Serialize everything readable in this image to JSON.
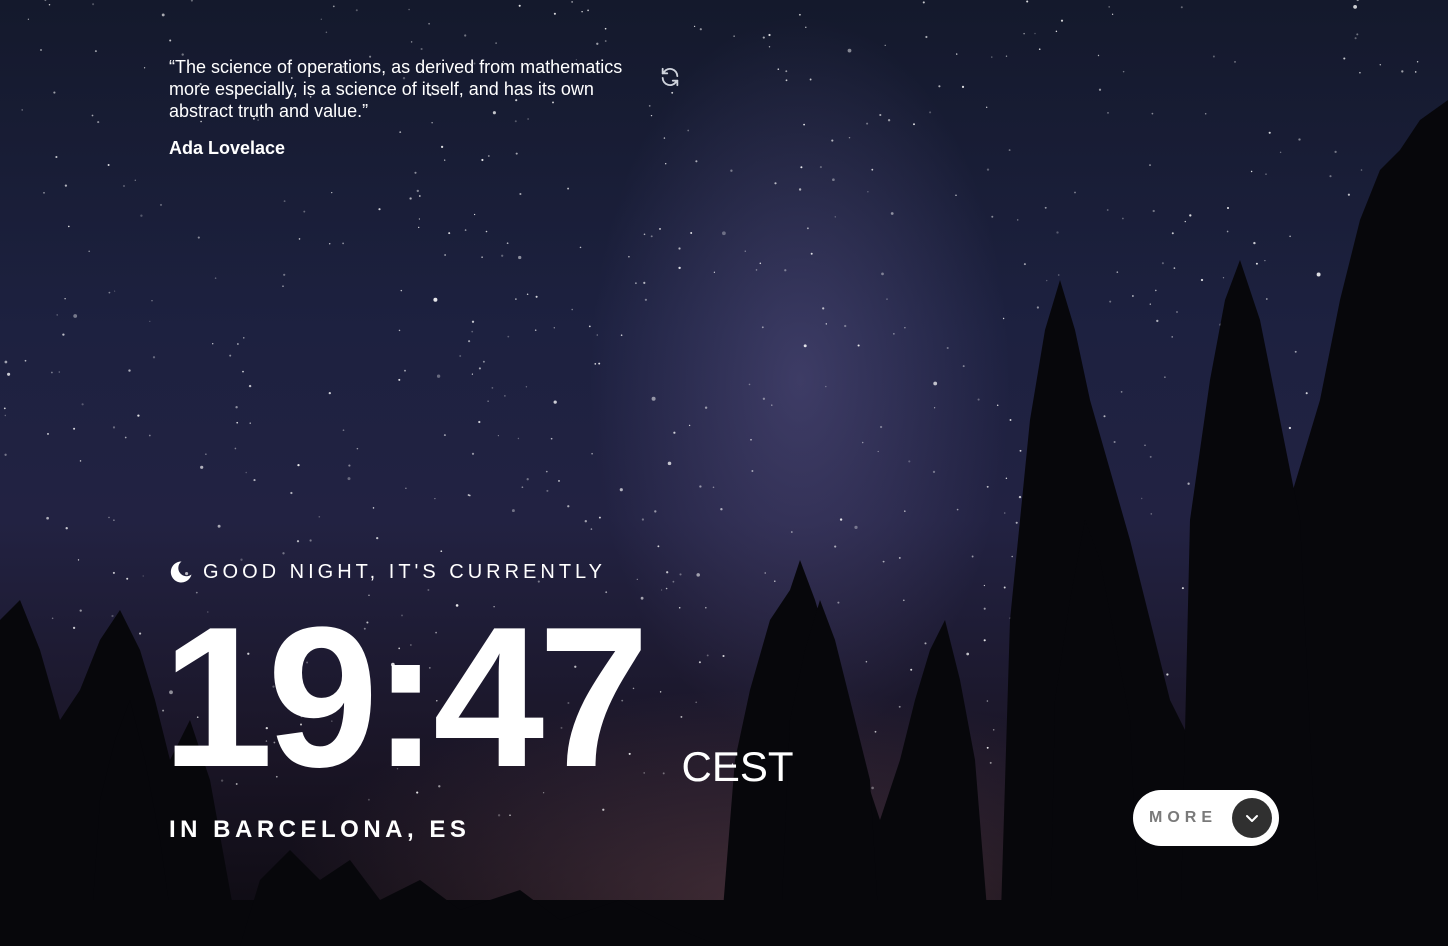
{
  "quote": {
    "text": "“The science of operations, as derived from mathematics more especially, is a science of itself, and has its own abstract truth and value.”",
    "author": "Ada Lovelace"
  },
  "clock": {
    "greeting": "GOOD NIGHT, IT'S CURRENTLY",
    "time": "19:47",
    "timezone": "CEST",
    "location": "IN BARCELONA, ES"
  },
  "more_button": {
    "label": "MORE"
  },
  "icons": {
    "refresh": "refresh-icon",
    "moon": "moon-icon",
    "chevron": "chevron-down-icon"
  },
  "colors": {
    "text": "#ffffff",
    "button_bg": "#ffffff",
    "button_label": "#7a7a7a",
    "button_circle": "#303030"
  }
}
